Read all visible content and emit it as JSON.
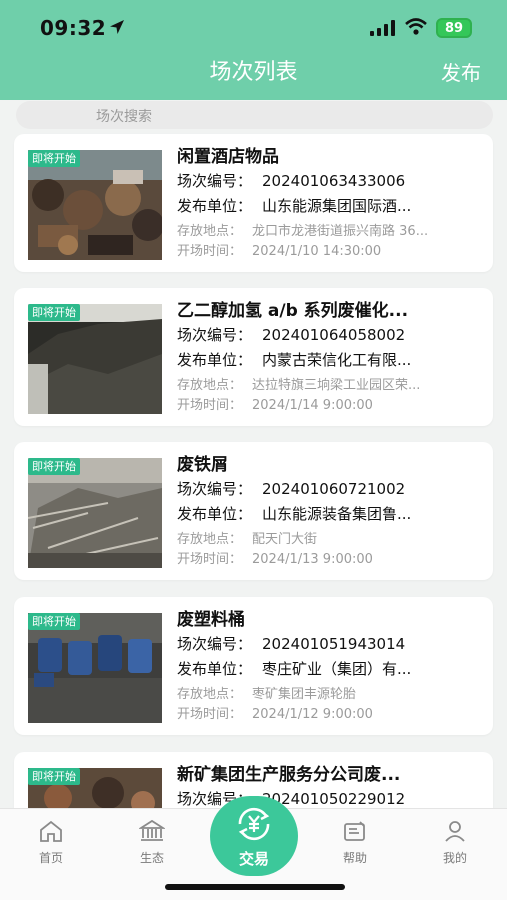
{
  "status": {
    "time": "09:32",
    "battery": "89"
  },
  "nav": {
    "title": "场次列表",
    "action": "发布"
  },
  "search": {
    "placeholder": "场次搜索"
  },
  "labels": {
    "no": "场次编号：",
    "unit": "发布单位：",
    "place": "存放地点：",
    "start": "开场时间："
  },
  "items": [
    {
      "badge": "即将开始",
      "title": "闲置酒店物品",
      "no": "202401063433006",
      "unit": "山东能源集团国际酒...",
      "place": "龙口市龙港街道振兴南路 36...",
      "time": "2024/1/10 14:30:00"
    },
    {
      "badge": "即将开始",
      "title": "乙二醇加氢 a/b 系列废催化...",
      "no": "202401064058002",
      "unit": "内蒙古荣信化工有限...",
      "place": "达拉特旗三垧梁工业园区荣...",
      "time": "2024/1/14 9:00:00"
    },
    {
      "badge": "即将开始",
      "title": "废铁屑",
      "no": "202401060721002",
      "unit": "山东能源装备集团鲁...",
      "place": "配天门大街",
      "time": "2024/1/13 9:00:00"
    },
    {
      "badge": "即将开始",
      "title": "废塑料桶",
      "no": "202401051943014",
      "unit": "枣庄矿业（集团）有...",
      "place": "枣矿集团丰源轮胎",
      "time": "2024/1/12 9:00:00"
    },
    {
      "badge": "即将开始",
      "title": "新矿集团生产服务分公司废...",
      "no": "202401050229012",
      "unit": "",
      "place": "",
      "time": ""
    }
  ],
  "tabs": {
    "home": "首页",
    "eco": "生态",
    "trade": "交易",
    "help": "帮助",
    "mine": "我的"
  },
  "colors": {
    "header": "#6fcfaa",
    "accent": "#3cc89a",
    "badge": "#2db98b"
  }
}
